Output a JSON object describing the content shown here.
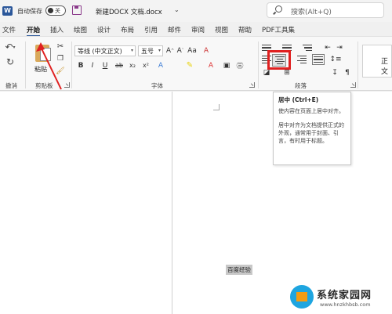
{
  "titlebar": {
    "autosave_label": "自动保存",
    "autosave_state": "关",
    "doc_title": "新建DOCX 文档.docx",
    "search_placeholder": "搜索(Alt+Q)"
  },
  "tabs": [
    {
      "label": "文件"
    },
    {
      "label": "开始"
    },
    {
      "label": "插入"
    },
    {
      "label": "绘图"
    },
    {
      "label": "设计"
    },
    {
      "label": "布局"
    },
    {
      "label": "引用"
    },
    {
      "label": "邮件"
    },
    {
      "label": "审阅"
    },
    {
      "label": "视图"
    },
    {
      "label": "帮助"
    },
    {
      "label": "PDF工具集"
    }
  ],
  "ribbon": {
    "groups": {
      "undo": "撤消",
      "clipboard": "剪贴板",
      "font": "字体",
      "paragraph": "段落"
    },
    "paste_label": "粘贴",
    "font_name": "等线 (中文正文)",
    "font_size": "五号",
    "style_preview": "正文",
    "font_buttons": [
      "B",
      "I",
      "U",
      "ab",
      "x₂",
      "x²",
      "A",
      "A"
    ],
    "size_buttons": [
      "A^",
      "A˅",
      "Aa",
      "A"
    ]
  },
  "tooltip": {
    "title": "居中 (Ctrl+E)",
    "desc1": "使内容在页面上居中对齐。",
    "desc2": "居中对齐为文档提供正式的外观，通常用于封面、引言，有时用于标题。"
  },
  "document": {
    "selected_text": "百度经验"
  },
  "watermark": {
    "name": "系统家园网",
    "url": "www.hnzkhbsb.com"
  },
  "colors": {
    "accent": "#2b579a",
    "highlight_box": "#e02020"
  }
}
